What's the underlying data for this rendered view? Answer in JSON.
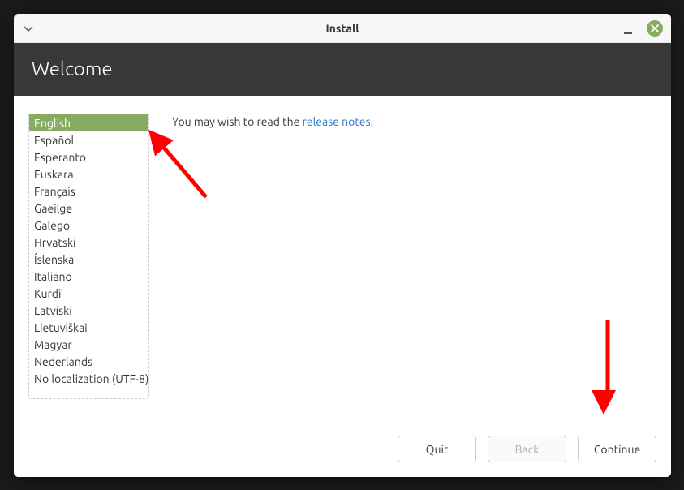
{
  "titlebar": {
    "title": "Install"
  },
  "header": {
    "title": "Welcome"
  },
  "hint": {
    "prefix": "You may wish to read the ",
    "link_text": "release notes",
    "suffix": "."
  },
  "languages": {
    "selected_index": 0,
    "items": [
      "English",
      "Español",
      "Esperanto",
      "Euskara",
      "Français",
      "Gaeilge",
      "Galego",
      "Hrvatski",
      "Íslenska",
      "Italiano",
      "Kurdî",
      "Latviski",
      "Lietuviškai",
      "Magyar",
      "Nederlands",
      "No localization (UTF-8)"
    ]
  },
  "buttons": {
    "quit": "Quit",
    "back": "Back",
    "continue": "Continue"
  },
  "colors": {
    "accent": "#87ab63",
    "header_bg": "#383838"
  }
}
